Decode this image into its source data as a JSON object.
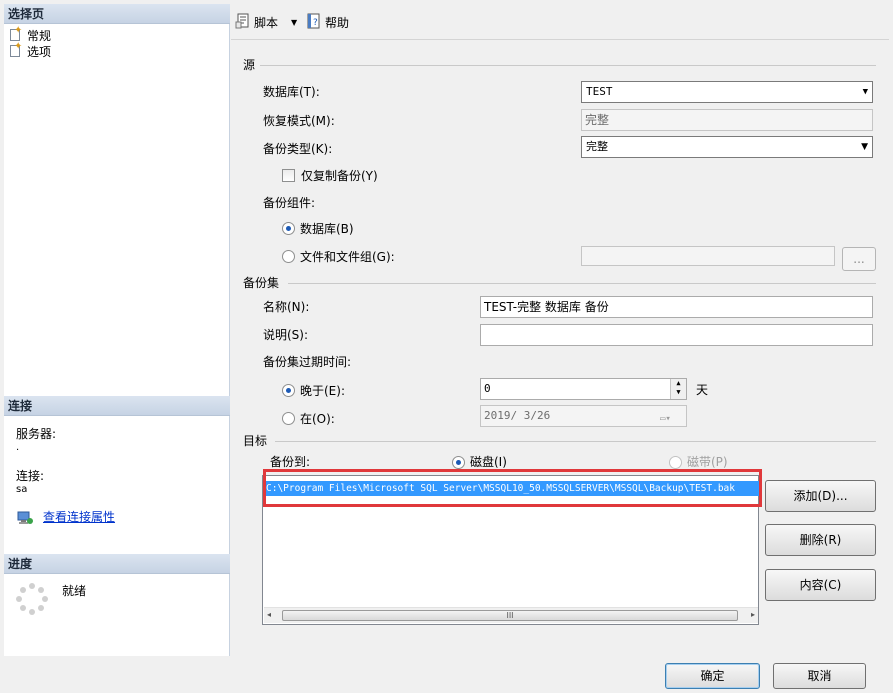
{
  "left": {
    "select_page_header": "选择页",
    "nav_items": [
      {
        "label": "常规",
        "icon": "page-settings-icon"
      },
      {
        "label": "选项",
        "icon": "page-settings-icon"
      }
    ],
    "connection_header": "连接",
    "server_label": "服务器:",
    "server_value": ".",
    "connection_label": "连接:",
    "connection_value": "sa",
    "view_connection_link": "查看连接属性",
    "progress_header": "进度",
    "progress_status": "就绪"
  },
  "toolbar": {
    "script_label": "脚本",
    "help_label": "帮助"
  },
  "source": {
    "section_title": "源",
    "database_label": "数据库(T):",
    "database_value": "TEST",
    "recovery_label": "恢复模式(M):",
    "recovery_value": "完整",
    "backup_type_label": "备份类型(K):",
    "backup_type_value": "完整",
    "copy_only_label": "仅复制备份(Y)",
    "copy_only_checked": false,
    "component_label": "备份组件:",
    "component_database_label": "数据库(B)",
    "component_files_label": "文件和文件组(G):",
    "files_browse_label": "...",
    "selected_component": "database"
  },
  "backup_set": {
    "section_title": "备份集",
    "name_label": "名称(N):",
    "name_value": "TEST-完整 数据库 备份",
    "description_label": "说明(S):",
    "description_value": "",
    "expire_label": "备份集过期时间:",
    "after_label": "晚于(E):",
    "after_value": "0",
    "after_unit": "天",
    "on_label": "在(O):",
    "on_value": "2019/ 3/26",
    "selected_expire": "after"
  },
  "destination": {
    "section_title": "目标",
    "backup_to_label": "备份到:",
    "disk_label": "磁盘(I)",
    "tape_label": "磁带(P)",
    "selected_media": "disk",
    "paths": [
      "C:\\Program Files\\Microsoft SQL Server\\MSSQL10_50.MSSQLSERVER\\MSSQL\\Backup\\TEST.bak"
    ],
    "scroll_grip": "III",
    "add_button": "添加(D)...",
    "remove_button": "删除(R)",
    "contents_button": "内容(C)"
  },
  "footer": {
    "ok_button": "确定",
    "cancel_button": "取消"
  },
  "colors": {
    "accent": "#1d5ab5",
    "highlight_border": "#e0383b",
    "selection": "#3399ff"
  }
}
